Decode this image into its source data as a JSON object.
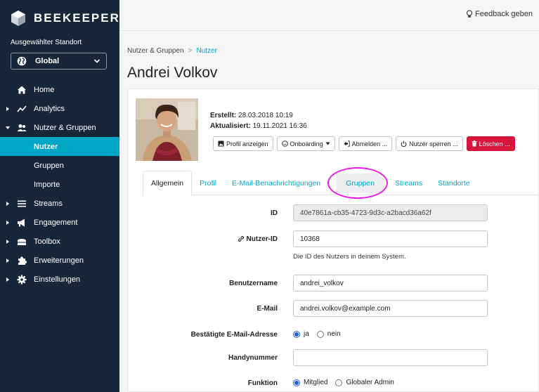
{
  "brand": {
    "name": "BEEKEEPER"
  },
  "location": {
    "label": "Ausgewählter Standort",
    "value": "Global"
  },
  "nav": [
    {
      "label": "Home",
      "icon": "home-icon",
      "caret": false,
      "active": false,
      "sub": false
    },
    {
      "label": "Analytics",
      "icon": "analytics-icon",
      "caret": "right",
      "active": false,
      "sub": false
    },
    {
      "label": "Nutzer & Gruppen",
      "icon": "users-icon",
      "caret": "down",
      "active": false,
      "sub": false
    },
    {
      "label": "Nutzer",
      "icon": "",
      "caret": false,
      "active": true,
      "sub": true
    },
    {
      "label": "Gruppen",
      "icon": "",
      "caret": false,
      "active": false,
      "sub": true
    },
    {
      "label": "Importe",
      "icon": "",
      "caret": false,
      "active": false,
      "sub": true
    },
    {
      "label": "Streams",
      "icon": "streams-icon",
      "caret": "right",
      "active": false,
      "sub": false
    },
    {
      "label": "Engagement",
      "icon": "megaphone-icon",
      "caret": "right",
      "active": false,
      "sub": false
    },
    {
      "label": "Toolbox",
      "icon": "toolbox-icon",
      "caret": "right",
      "active": false,
      "sub": false
    },
    {
      "label": "Erweiterungen",
      "icon": "puzzle-icon",
      "caret": "right",
      "active": false,
      "sub": false
    },
    {
      "label": "Einstellungen",
      "icon": "gear-icon",
      "caret": "right",
      "active": false,
      "sub": false
    }
  ],
  "topbar": {
    "feedback": "Feedback geben"
  },
  "breadcrumb": {
    "parent": "Nutzer & Gruppen",
    "separator": ">",
    "current": "Nutzer"
  },
  "page": {
    "title": "Andrei Volkov"
  },
  "user": {
    "created_label": "Erstellt:",
    "created_value": "28.03.2018 10:19",
    "updated_label": "Aktualisiert:",
    "updated_value": "19.11.2021 16:36"
  },
  "actions": {
    "profile": "Profil anzeigen",
    "onboarding": "Onboarding",
    "logout": "Abmelden ...",
    "lock": "Nutzer sperren ...",
    "delete": "Löschen ..."
  },
  "tabs": [
    "Allgemein",
    "Profil",
    "E-Mail-Benachrichtigungen",
    "Gruppen",
    "Streams",
    "Standorte"
  ],
  "form": {
    "id_label": "ID",
    "id_value": "40e7861a-cb35-4723-9d3c-a2bacd36a62f",
    "userid_label": "Nutzer-ID",
    "userid_value": "10368",
    "userid_help": "Die ID des Nutzers in deinem System.",
    "username_label": "Benutzername",
    "username_value": "andrei_volkov",
    "email_label": "E-Mail",
    "email_value": "andrei.volkov@example.com",
    "confirmed_label": "Bestätigte E-Mail-Adresse",
    "confirmed_yes": "ja",
    "confirmed_no": "nein",
    "phone_label": "Handynummer",
    "phone_value": "",
    "role_label": "Funktion",
    "role_member": "Mitglied",
    "role_admin": "Globaler Admin"
  },
  "colors": {
    "sidebar": "#17273a",
    "accent": "#00a6c6",
    "danger": "#d6163c",
    "highlight": "#e81ee8"
  }
}
